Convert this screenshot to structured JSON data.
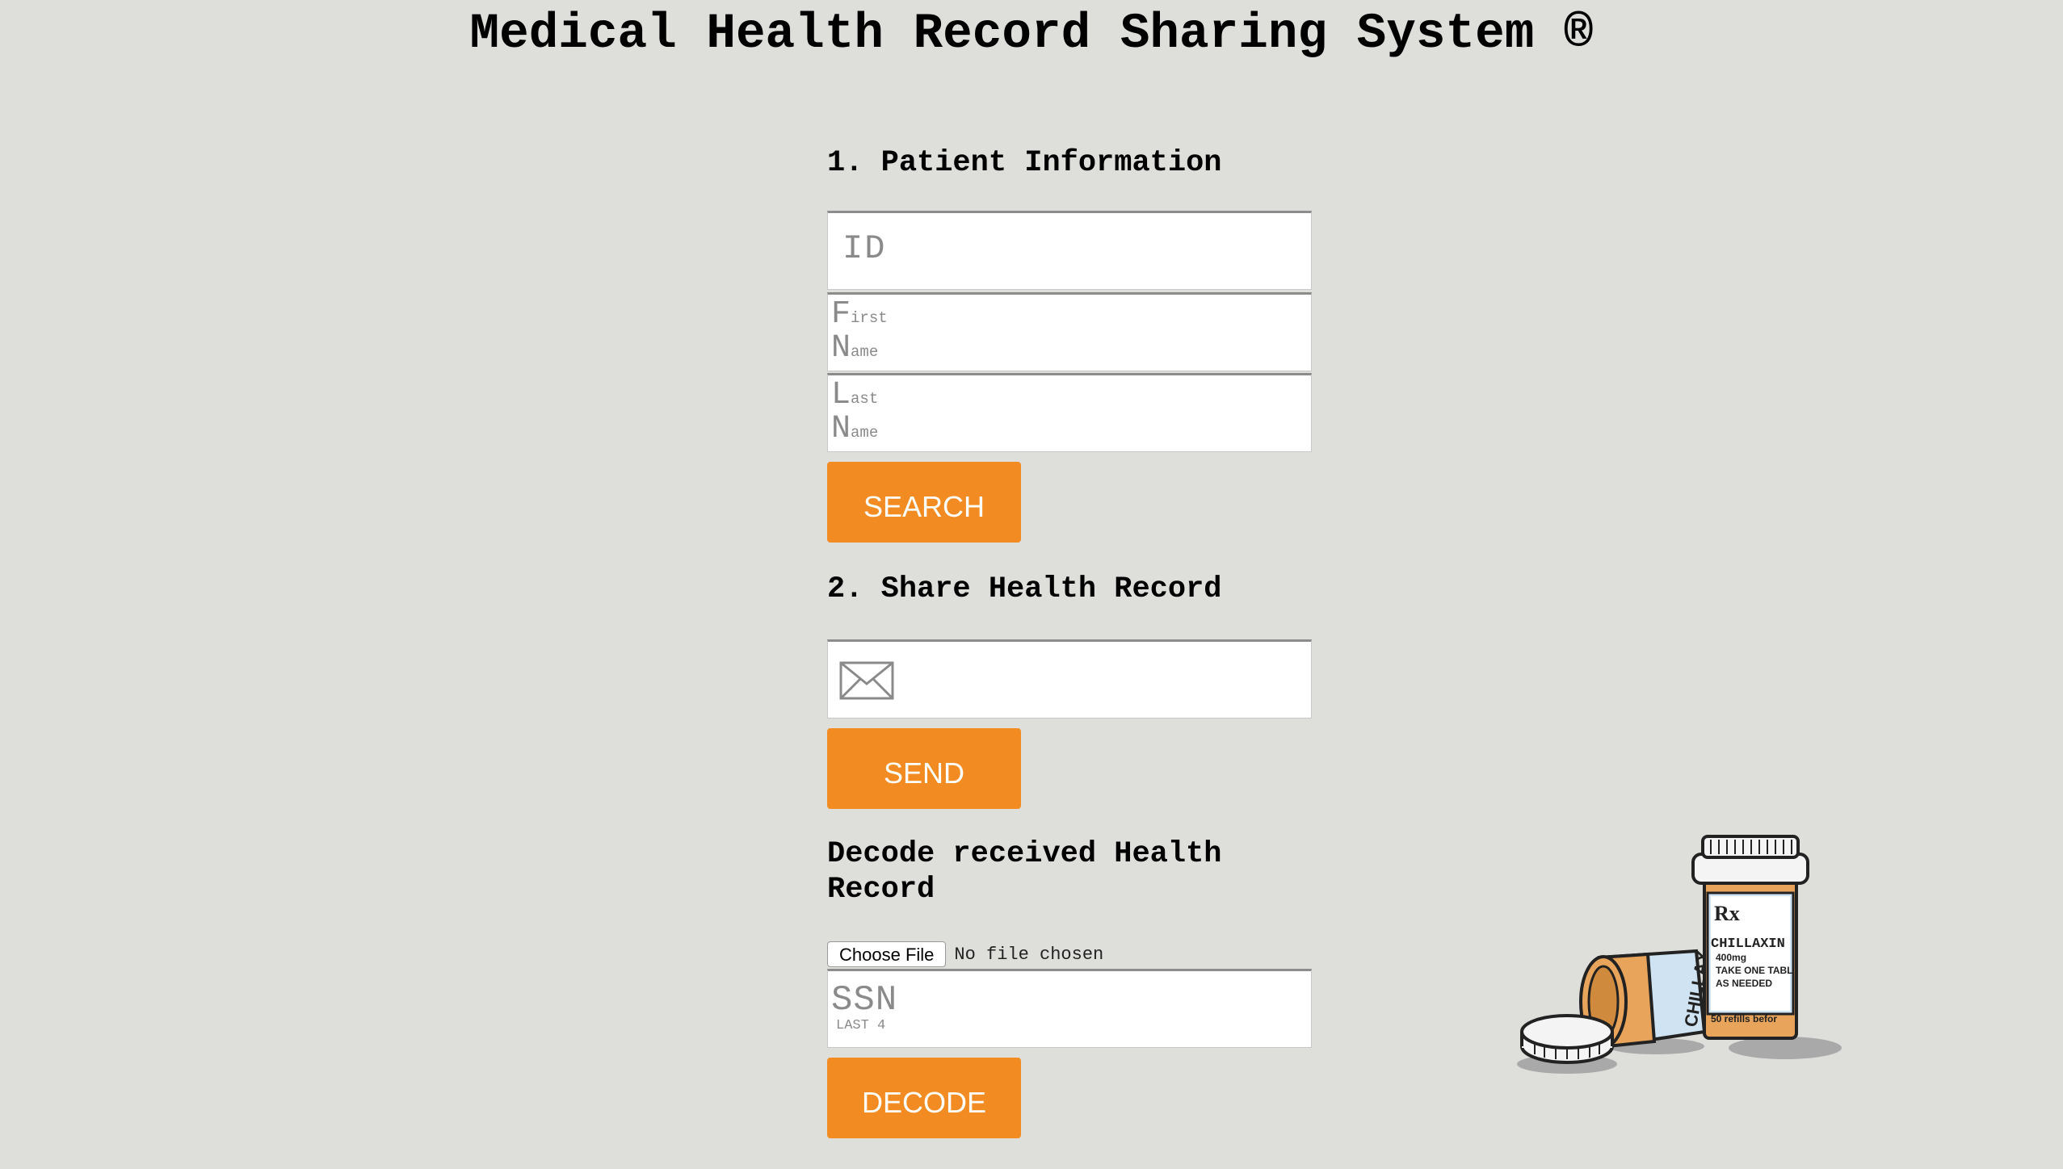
{
  "header": {
    "title": "Medical Health Record Sharing System ®"
  },
  "patient_section": {
    "heading": "1. Patient Information",
    "id_placeholder": "ID",
    "first_name_placeholder": {
      "line1_cap": "F",
      "line1_rest": "irst",
      "line2_cap": "N",
      "line2_rest": "ame"
    },
    "last_name_placeholder": {
      "line1_cap": "L",
      "line1_rest": "ast",
      "line2_cap": "N",
      "line2_rest": "ame"
    },
    "search_label": "SEARCH"
  },
  "share_section": {
    "heading": "2. Share Health Record",
    "email_icon": "envelope-icon",
    "send_label": "SEND"
  },
  "decode_section": {
    "heading": "Decode received Health\nRecord",
    "choose_file_label": "Choose File",
    "file_status": "No file chosen",
    "ssn_placeholder_big": "SSN",
    "ssn_placeholder_small": "LAST 4",
    "decode_label": "DECODE"
  },
  "illustration": {
    "name": "pill-bottles-illustration",
    "label_brand": "CHILLAXIN",
    "label_dose": "400mg",
    "label_line1": "TAKE ONE TABL",
    "label_line2": "AS NEEDED",
    "label_refills": "50 refills befor",
    "side_label": "CHILLAX",
    "rx": "Rx",
    "colors": {
      "orange": "#e8a45a",
      "cap_white": "#f4f4f4",
      "label_blue": "#cfe3f2",
      "outline": "#222222"
    }
  },
  "colors": {
    "background": "#dedfdb",
    "button": "#f28c22",
    "button_text": "#ffffff",
    "placeholder": "#8a8a8a"
  }
}
